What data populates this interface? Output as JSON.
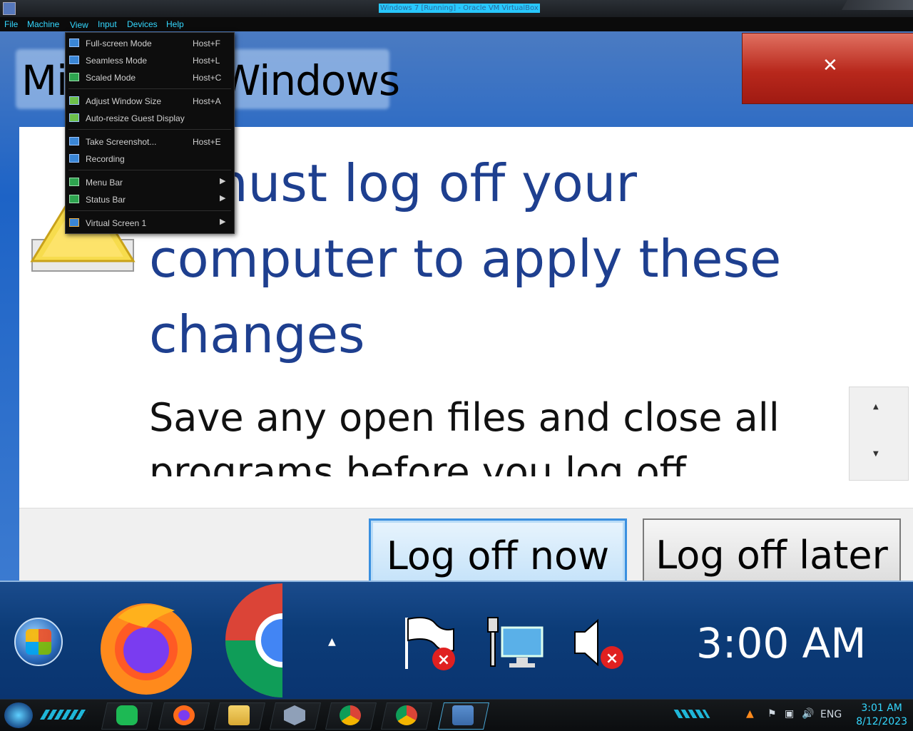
{
  "host_window": {
    "title": "Windows 7 [Running] - Oracle VM VirtualBox",
    "menu": [
      "File",
      "Machine",
      "View",
      "Input",
      "Devices",
      "Help"
    ]
  },
  "view_menu": {
    "items": [
      {
        "label": "Full-screen Mode",
        "shortcut": "Host+F",
        "icon": "fullscreen-icon"
      },
      {
        "label": "Seamless Mode",
        "shortcut": "Host+L",
        "icon": "seamless-icon"
      },
      {
        "label": "Scaled Mode",
        "shortcut": "Host+C",
        "icon": "scaled-icon"
      },
      {
        "label": "Adjust Window Size",
        "shortcut": "Host+A",
        "icon": "adjust-window-icon"
      },
      {
        "label": "Auto-resize Guest Display",
        "shortcut": "",
        "icon": "auto-resize-icon"
      },
      {
        "label": "Take Screenshot...",
        "shortcut": "Host+E",
        "icon": "camera-icon"
      },
      {
        "label": "Recording",
        "shortcut": "",
        "icon": "recording-icon"
      },
      {
        "label": "Menu Bar",
        "shortcut": "",
        "icon": "menu-bar-icon",
        "submenu": true
      },
      {
        "label": "Status Bar",
        "shortcut": "",
        "icon": "status-bar-icon",
        "submenu": true
      },
      {
        "label": "Virtual Screen 1",
        "shortcut": "",
        "icon": "virtual-screen-icon",
        "submenu": true
      }
    ]
  },
  "dialog": {
    "title_visible": "Windows",
    "title_partial": "Mi",
    "headline": "You must log off your computer to apply these changes",
    "headline_visible_start": "u must log off your",
    "headline_line2": "computer to apply these",
    "headline_line3": "changes",
    "subtext_line1": "Save any open files and close all",
    "subtext_line2": "programs before you log off",
    "close_glyph": "✕",
    "buttons": {
      "log_off_now": "Log off now",
      "log_off_later": "Log off later"
    }
  },
  "guest_taskbar": {
    "clock": "3:00 AM",
    "tray_icons": [
      "action-center-flag-icon",
      "network-icon",
      "speaker-muted-icon"
    ],
    "pinned": [
      "firefox-icon",
      "chrome-icon"
    ]
  },
  "host_taskbar": {
    "language": "ENG",
    "time": "3:01 AM",
    "date": "8/12/2023",
    "apps": [
      "notes-icon",
      "firefox-icon",
      "file-explorer-icon",
      "virtualbox-cube-icon",
      "chrome-icon",
      "chrome-profile-icon",
      "virtualbox-win7-icon"
    ],
    "colors": {
      "accent": "#34d8ff",
      "dialog_headline": "#1e3f8f",
      "close_red": "#b8281c"
    }
  }
}
